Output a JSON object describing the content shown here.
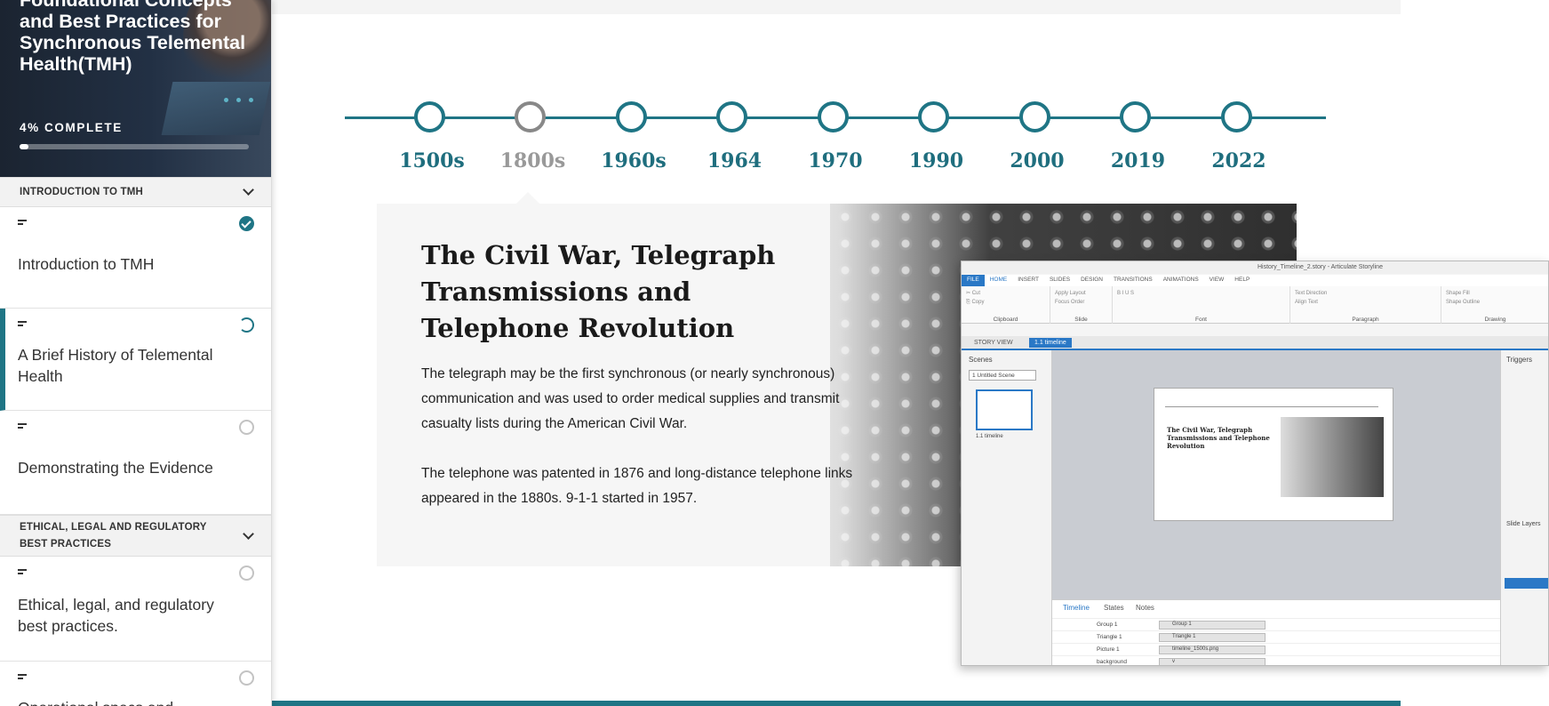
{
  "course": {
    "title": "Foundational Concepts and Best Practices for Synchronous Telemental Health(TMH)",
    "progress_label": "4% COMPLETE",
    "progress": 0.04
  },
  "sections": [
    {
      "label": "INTRODUCTION TO TMH"
    },
    {
      "label": "ETHICAL, LEGAL AND REGULATORY BEST PRACTICES"
    }
  ],
  "lessons": [
    {
      "title": "Introduction to TMH",
      "status": "complete"
    },
    {
      "title": "A Brief History of Telemental Health",
      "status": "in-progress"
    },
    {
      "title": "Demonstrating the Evidence",
      "status": "not-started"
    },
    {
      "title": "Ethical, legal, and regulatory best practices.",
      "status": "not-started"
    },
    {
      "title": "Operational specs and",
      "status": "not-started"
    }
  ],
  "timeline": {
    "years": [
      "1500s",
      "1800s",
      "1960s",
      "1964",
      "1970",
      "1990",
      "2000",
      "2019",
      "2022"
    ],
    "selected": "1800s"
  },
  "card": {
    "title": "The Civil War, Telegraph Transmissions and Telephone Revolution",
    "paragraph1": "The telegraph may be the first synchronous (or nearly synchronous) communication and was used to order medical supplies and transmit casualty lists during the American Civil War.",
    "paragraph2": "The telephone was patented in 1876 and long-distance telephone links appeared in the 1880s. 9-1-1 started in 1957."
  },
  "storyline": {
    "window_title": "History_Timeline_2.story - Articulate Storyline",
    "ribbon_tabs": [
      "FILE",
      "HOME",
      "INSERT",
      "SLIDES",
      "DESIGN",
      "TRANSITIONS",
      "ANIMATIONS",
      "VIEW",
      "HELP"
    ],
    "ribbon_groups": [
      "Clipboard",
      "Slide",
      "Font",
      "Paragraph",
      "Drawing"
    ],
    "view_tabs": [
      "STORY VIEW",
      "1.1 timeline"
    ],
    "scenes_label": "Scenes",
    "scene_select": "1 Untitled Scene",
    "slide_thumb_label": "1.1 timeline",
    "triggers_label": "Triggers",
    "slide_layers_label": "Slide Layers",
    "timeline_tabs": [
      "Timeline",
      "States",
      "Notes"
    ],
    "timeline_rows": [
      {
        "name": "Group 1",
        "bar": "Group 1"
      },
      {
        "name": "Triangle 1",
        "bar": "Triangle 1"
      },
      {
        "name": "Picture 1",
        "bar": "timeline_1500s.png"
      },
      {
        "name": "background",
        "bar": "v"
      }
    ]
  },
  "colors": {
    "accent": "#1f7585",
    "selected_grey": "#888888"
  }
}
